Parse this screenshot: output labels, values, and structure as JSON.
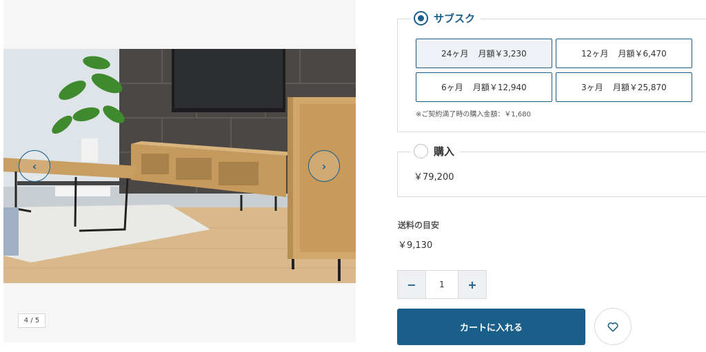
{
  "gallery": {
    "prev_arrow": "‹",
    "next_arrow": "›",
    "counter": "4 / 5"
  },
  "options": {
    "subscription": {
      "title": "サブスク",
      "checked": true,
      "plans": [
        {
          "term": "24ヶ月",
          "price": "月額￥3,230",
          "selected": true
        },
        {
          "term": "12ヶ月",
          "price": "月額￥6,470",
          "selected": false
        },
        {
          "term": "6ヶ月",
          "price": "月額￥12,940",
          "selected": false
        },
        {
          "term": "3ヶ月",
          "price": "月額￥25,870",
          "selected": false
        }
      ],
      "note": "※ご契約満了時の購入金額：￥1,680"
    },
    "purchase": {
      "title": "購入",
      "checked": false,
      "price": "￥79,200"
    }
  },
  "shipping": {
    "label": "送料の目安",
    "price": "￥9,130"
  },
  "quantity": {
    "minus": "−",
    "value": "1",
    "plus": "+"
  },
  "cart": {
    "button_label": "カートに入れる"
  },
  "icons": {
    "favorite": "heart-icon"
  },
  "colors": {
    "accent": "#1a5f8a",
    "selected_plan_bg": "#eef1f5",
    "border": "#d9d9d9"
  }
}
